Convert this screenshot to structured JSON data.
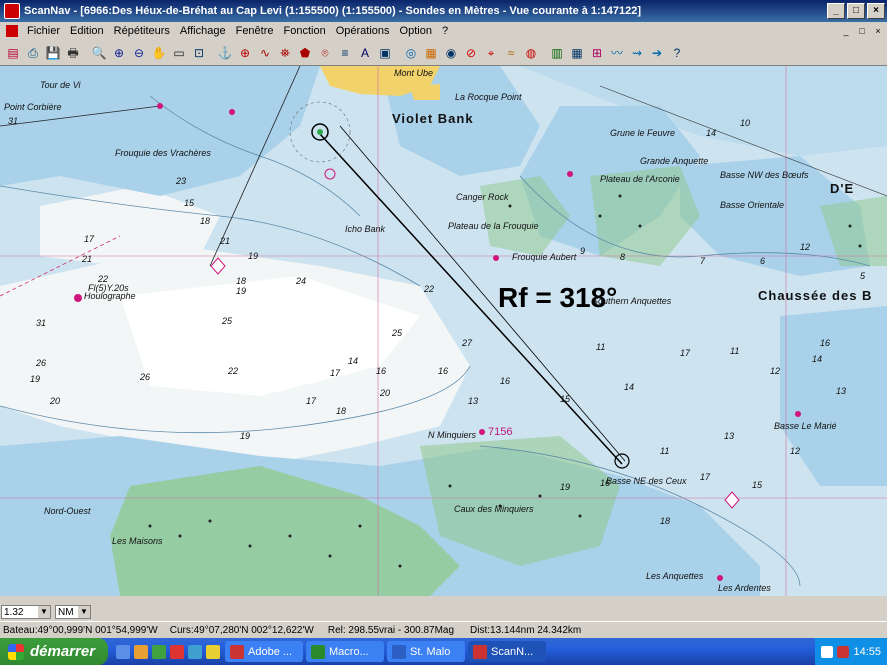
{
  "window": {
    "app_name": "ScanNav",
    "title": "ScanNav - [6966:Des Héux-de-Bréhat au Cap Levi (1:155500) (1:155500) - Sondes en  Mètres  - Vue courante à 1:147122]",
    "buttons": {
      "minimize": "_",
      "maximize": "□",
      "close": "×"
    }
  },
  "menu": {
    "items": [
      "Fichier",
      "Edition",
      "Répétiteurs",
      "Affichage",
      "Fenêtre",
      "Fonction",
      "Opérations",
      "Option",
      "?"
    ],
    "mdi_buttons": [
      "_",
      "□",
      "×"
    ]
  },
  "toolbar": {
    "icons": [
      "open-chart-icon",
      "print-chart-icon",
      "save-icon",
      "printer-icon",
      "search-icon",
      "zoom-in-icon",
      "zoom-out-icon",
      "hand-pan-icon",
      "select-rect-icon",
      "page-icon",
      "anchor-icon",
      "target-icon",
      "route-icon",
      "waypoint-icon",
      "mark-icon",
      "compass-icon",
      "layers-icon",
      "text-icon",
      "window-icon",
      "radar-icon",
      "depth-icon",
      "nav-icon",
      "alarm-icon",
      "gps-icon",
      "tide-icon",
      "lifebuoy-icon",
      "table-icon",
      "grid-icon",
      "chart-icon",
      "wave-icon",
      "wind-icon",
      "arrow-icon",
      "help-icon"
    ],
    "glyphs": [
      "▤",
      "⎙",
      "💾",
      "🖶",
      "🔍",
      "⊕",
      "⊖",
      "✋",
      "▭",
      "⊡",
      "⚓",
      "⊕",
      "∿",
      "⛯",
      "⬟",
      "⌾",
      "≡",
      "A",
      "▣",
      "◎",
      "▦",
      "◉",
      "⊘",
      "⌖",
      "≈",
      "◍",
      "▥",
      "▦",
      "⊞",
      "〰",
      "⇝",
      "➔",
      "?"
    ]
  },
  "map": {
    "overlay_text": "Rf = 318°",
    "labels": [
      {
        "text": "Violet Bank",
        "cls": "big"
      },
      {
        "text": "Plateau de la Frouquie",
        "cls": "italic"
      },
      {
        "text": "Plateau de l'Arconie",
        "cls": "italic"
      },
      {
        "text": "Chaussée des B",
        "cls": "big"
      },
      {
        "text": "D'E",
        "cls": "big"
      },
      {
        "text": "Houlographe",
        "cls": "italic"
      },
      {
        "text": "Basse NE des Ceux",
        "cls": "italic"
      },
      {
        "text": "7156",
        "cls": "mag"
      },
      {
        "text": "N Minquiers",
        "cls": "italic"
      },
      {
        "text": "Southern Anquettes",
        "cls": "italic"
      },
      {
        "text": "Grande Anquette",
        "cls": "italic"
      },
      {
        "text": "Basse NW des Bœufs",
        "cls": "italic"
      },
      {
        "text": "Basse Orientale",
        "cls": "italic"
      },
      {
        "text": "Icho Bank",
        "cls": "italic"
      },
      {
        "text": "Canger Rock",
        "cls": "italic"
      },
      {
        "text": "Frouquie Aubert",
        "cls": "italic"
      },
      {
        "text": "Basse Le Marié",
        "cls": "italic"
      },
      {
        "text": "Grune le Feuvre",
        "cls": "italic"
      },
      {
        "text": "Les Anquettes",
        "cls": "italic"
      },
      {
        "text": "Fl(5)Y.20s",
        "cls": "italic"
      },
      {
        "text": "Mont Ube",
        "cls": "italic"
      },
      {
        "text": "La Rocque Point",
        "cls": "italic"
      },
      {
        "text": "Frouquie des Vrachères",
        "cls": "italic"
      },
      {
        "text": "Point Corbière",
        "cls": "italic"
      },
      {
        "text": "Tour de Vi",
        "cls": "italic"
      },
      {
        "text": "Les Maisons",
        "cls": "italic"
      },
      {
        "text": "Les Ardentes",
        "cls": "italic"
      },
      {
        "text": "Caux des Minquiers",
        "cls": "italic"
      },
      {
        "text": "Nord-Ouest",
        "cls": "italic"
      }
    ],
    "depths": [
      "31",
      "26",
      "23",
      "19",
      "24",
      "25",
      "22",
      "27",
      "25",
      "16",
      "17",
      "18",
      "19",
      "21",
      "22",
      "20",
      "13",
      "14",
      "16",
      "17",
      "18",
      "19",
      "15",
      "14",
      "16",
      "13",
      "12",
      "11",
      "17",
      "11",
      "9",
      "8",
      "7",
      "6",
      "5",
      "31",
      "26",
      "20",
      "19",
      "22",
      "21",
      "17",
      "18",
      "15",
      "10",
      "14",
      "12",
      "19",
      "16",
      "18",
      "17",
      "15",
      "16",
      "13",
      "14",
      "12",
      "11"
    ]
  },
  "scale": {
    "zoom_value": "1.32",
    "units_value": "NM"
  },
  "status": {
    "bateau": "Bateau:49°00,999'N 001°54,999'W",
    "curs": "Curs:49°07,280'N 002°12,622'W",
    "rel": "Rel: 298.55vrai - 300.87Mag",
    "dist": "Dist:13.144nm  24.342km"
  },
  "taskbar": {
    "start_label": "démarrer",
    "tasks": [
      {
        "label": "Adobe ...",
        "color": "#c33"
      },
      {
        "label": "Macro...",
        "color": "#2a8a2a"
      },
      {
        "label": "St. Malo",
        "color": "#2b5fc4"
      },
      {
        "label": "ScanN...",
        "color": "#c33"
      }
    ],
    "active_task": "ScanN...",
    "clock": "14:55"
  }
}
